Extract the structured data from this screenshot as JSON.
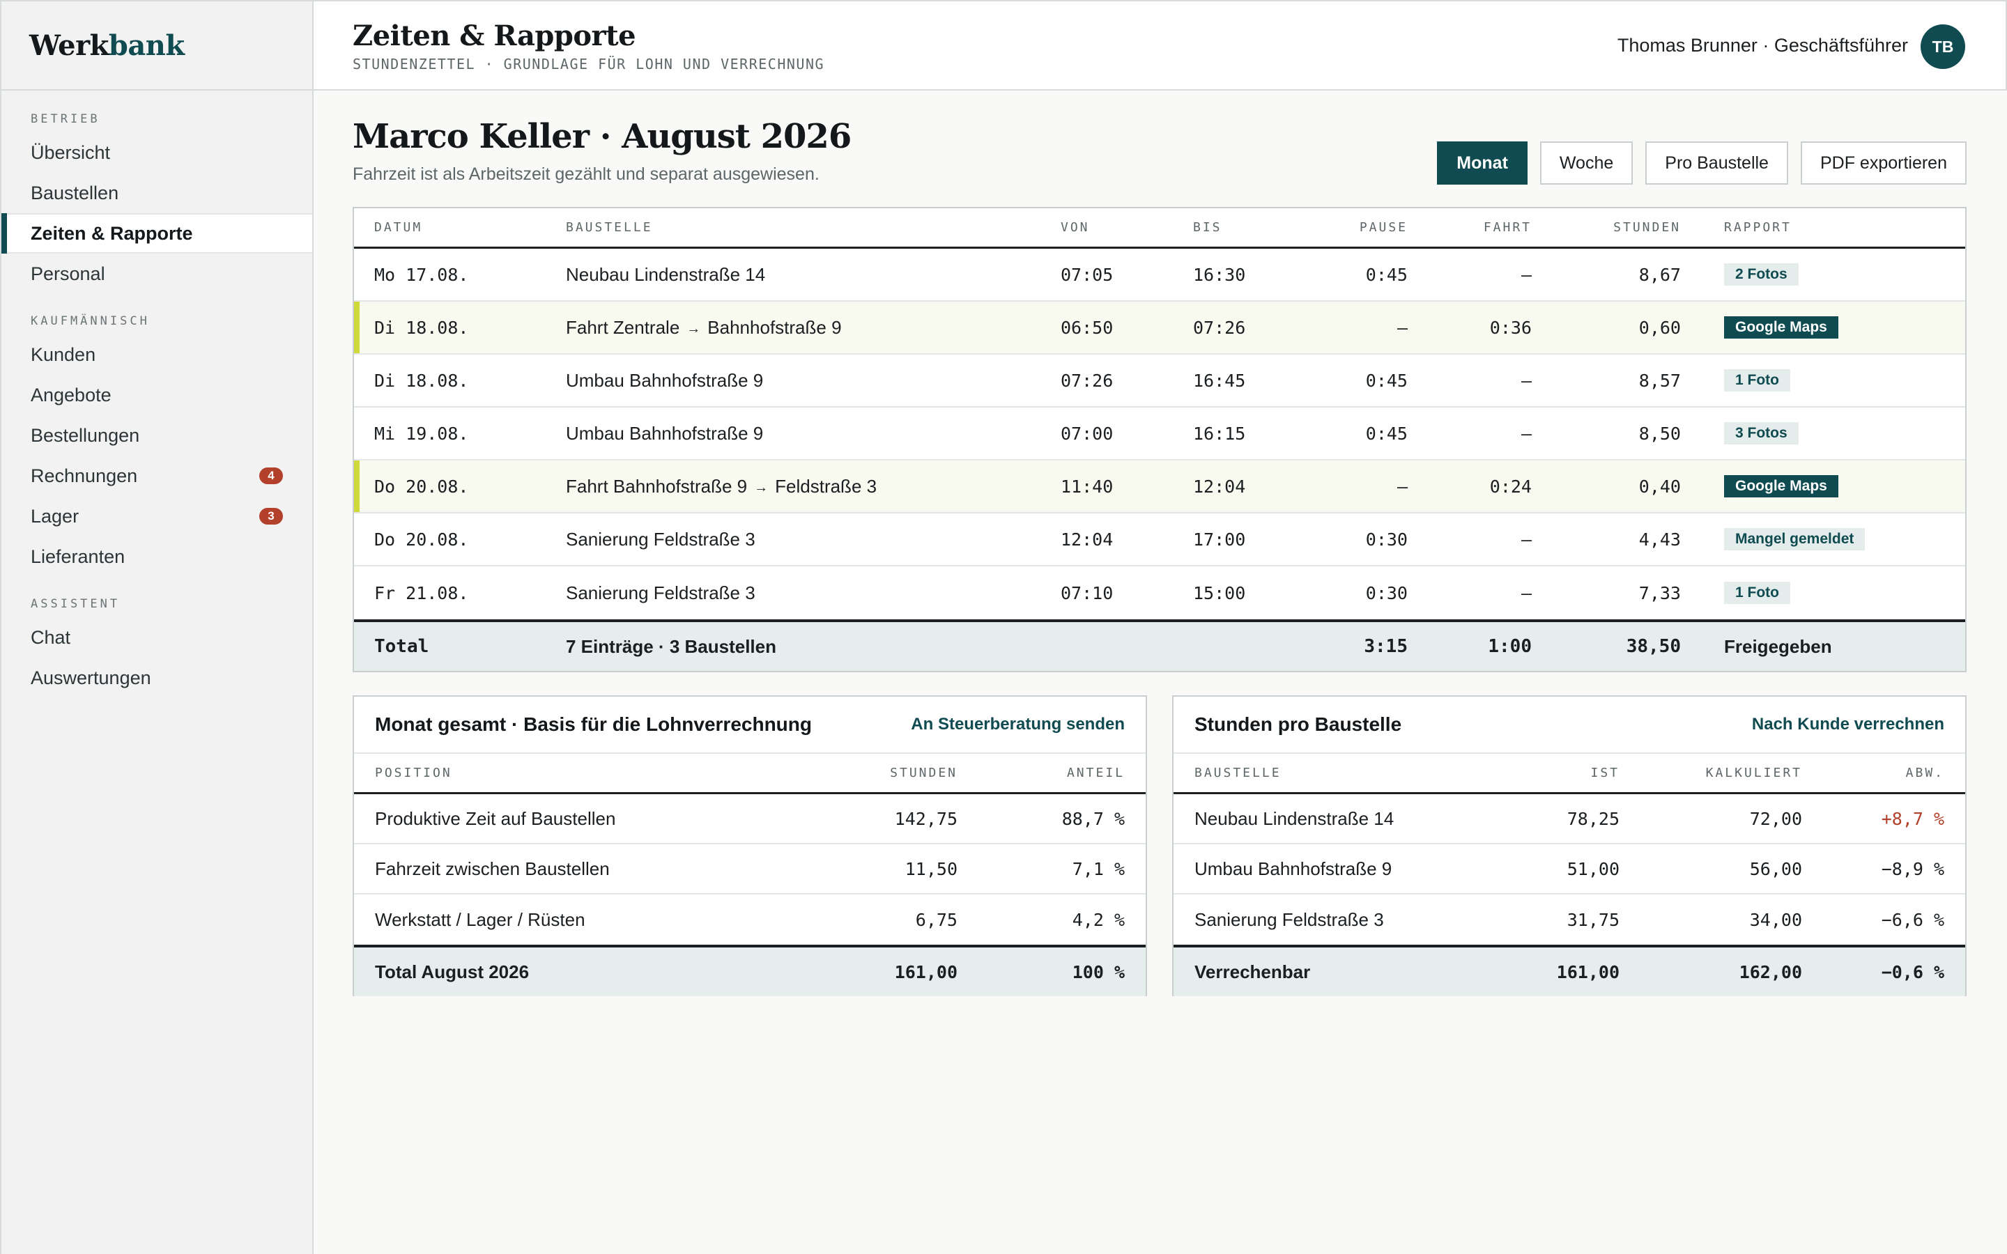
{
  "brand": {
    "part1": "Werk",
    "part2": "bank"
  },
  "sidebar": {
    "sections": [
      {
        "label": "BETRIEB",
        "items": [
          {
            "label": "Übersicht"
          },
          {
            "label": "Baustellen"
          },
          {
            "label": "Zeiten & Rapporte",
            "active": true
          },
          {
            "label": "Personal"
          }
        ]
      },
      {
        "label": "KAUFMÄNNISCH",
        "items": [
          {
            "label": "Kunden"
          },
          {
            "label": "Angebote"
          },
          {
            "label": "Bestellungen"
          },
          {
            "label": "Rechnungen",
            "badge": "4"
          },
          {
            "label": "Lager",
            "badge": "3"
          },
          {
            "label": "Lieferanten"
          }
        ]
      },
      {
        "label": "ASSISTENT",
        "items": [
          {
            "label": "Chat"
          },
          {
            "label": "Auswertungen"
          }
        ]
      }
    ]
  },
  "header": {
    "title": "Zeiten & Rapporte",
    "subtitle": "STUNDENZETTEL · GRUNDLAGE FÜR LOHN UND VERRECHNUNG",
    "user": "Thomas Brunner · Geschäftsführer",
    "avatar_initials": "TB"
  },
  "main": {
    "title": "Marco Keller · August 2026",
    "subtitle": "Fahrzeit ist als Arbeitszeit gezählt und separat ausgewiesen.",
    "view_buttons": [
      {
        "label": "Monat",
        "active": true
      },
      {
        "label": "Woche"
      },
      {
        "label": "Pro Baustelle"
      },
      {
        "label": "PDF exportieren"
      }
    ]
  },
  "time_table": {
    "columns": [
      "DATUM",
      "BAUSTELLE",
      "VON",
      "BIS",
      "PAUSE",
      "FAHRT",
      "STUNDEN",
      "RAPPORT"
    ],
    "rows": [
      {
        "datum": "Mo 17.08.",
        "baustelle": "Neubau Lindenstraße 14",
        "von": "07:05",
        "bis": "16:30",
        "pause": "0:45",
        "fahrt": "–",
        "stunden": "8,67",
        "rapport": "2 Fotos",
        "rapport_style": "light",
        "travel": false
      },
      {
        "datum": "Di 18.08.",
        "baustelle_from": "Fahrt Zentrale",
        "baustelle_to": "Bahnhofstraße 9",
        "von": "06:50",
        "bis": "07:26",
        "pause": "–",
        "fahrt": "0:36",
        "stunden": "0,60",
        "rapport": "Google Maps",
        "rapport_style": "dark",
        "travel": true
      },
      {
        "datum": "Di 18.08.",
        "baustelle": "Umbau Bahnhofstraße 9",
        "von": "07:26",
        "bis": "16:45",
        "pause": "0:45",
        "fahrt": "–",
        "stunden": "8,57",
        "rapport": "1 Foto",
        "rapport_style": "light",
        "travel": false
      },
      {
        "datum": "Mi 19.08.",
        "baustelle": "Umbau Bahnhofstraße 9",
        "von": "07:00",
        "bis": "16:15",
        "pause": "0:45",
        "fahrt": "–",
        "stunden": "8,50",
        "rapport": "3 Fotos",
        "rapport_style": "light",
        "travel": false
      },
      {
        "datum": "Do 20.08.",
        "baustelle_from": "Fahrt Bahnhofstraße 9",
        "baustelle_to": "Feldstraße 3",
        "von": "11:40",
        "bis": "12:04",
        "pause": "–",
        "fahrt": "0:24",
        "stunden": "0,40",
        "rapport": "Google Maps",
        "rapport_style": "dark",
        "travel": true
      },
      {
        "datum": "Do 20.08.",
        "baustelle": "Sanierung Feldstraße 3",
        "von": "12:04",
        "bis": "17:00",
        "pause": "0:30",
        "fahrt": "–",
        "stunden": "4,43",
        "rapport": "Mangel gemeldet",
        "rapport_style": "light",
        "travel": false
      },
      {
        "datum": "Fr 21.08.",
        "baustelle": "Sanierung Feldstraße 3",
        "von": "07:10",
        "bis": "15:00",
        "pause": "0:30",
        "fahrt": "–",
        "stunden": "7,33",
        "rapport": "1 Foto",
        "rapport_style": "light",
        "travel": false
      }
    ],
    "total": {
      "datum": "Total",
      "baustelle": "7 Einträge · 3 Baustellen",
      "pause": "3:15",
      "fahrt": "1:00",
      "stunden": "38,50",
      "rapport": "Freigegeben"
    },
    "arrow": "→"
  },
  "month_panel": {
    "title": "Monat gesamt · Basis für die Lohnverrechnung",
    "link": "An Steuerberatung senden",
    "columns": [
      "POSITION",
      "STUNDEN",
      "ANTEIL"
    ],
    "rows": [
      {
        "label": "Produktive Zeit auf Baustellen",
        "stunden": "142,75",
        "anteil": "88,7 %"
      },
      {
        "label": "Fahrzeit zwischen Baustellen",
        "stunden": "11,50",
        "anteil": "7,1 %"
      },
      {
        "label": "Werkstatt / Lager / Rüsten",
        "stunden": "6,75",
        "anteil": "4,2 %"
      }
    ],
    "total": {
      "label": "Total August 2026",
      "stunden": "161,00",
      "anteil": "100 %"
    }
  },
  "sites_panel": {
    "title": "Stunden pro Baustelle",
    "link": "Nach Kunde verrechnen",
    "columns": [
      "BAUSTELLE",
      "IST",
      "KALKULIERT",
      "ABW."
    ],
    "rows": [
      {
        "label": "Neubau Lindenstraße 14",
        "ist": "78,25",
        "kalkuliert": "72,00",
        "abw": "+8,7 %",
        "over": true
      },
      {
        "label": "Umbau Bahnhofstraße 9",
        "ist": "51,00",
        "kalkuliert": "56,00",
        "abw": "−8,9 %",
        "over": false
      },
      {
        "label": "Sanierung Feldstraße 3",
        "ist": "31,75",
        "kalkuliert": "34,00",
        "abw": "−6,6 %",
        "over": false
      }
    ],
    "total": {
      "label": "Verrechenbar",
      "ist": "161,00",
      "kalkuliert": "162,00",
      "abw": "−0,6 %"
    }
  },
  "colors": {
    "accent": "#0f4b50",
    "badge": "#b3402a",
    "travel_marker": "#cfd93a",
    "over_budget": "#b3402a"
  }
}
